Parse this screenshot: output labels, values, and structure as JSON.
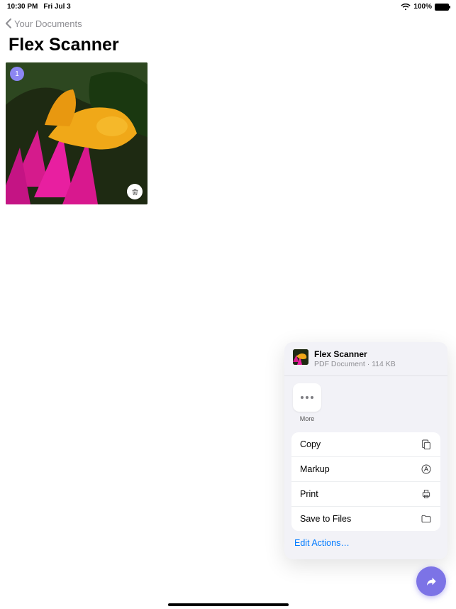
{
  "status": {
    "time": "10:30 PM",
    "date": "Fri Jul 3",
    "battery_pct": "100%"
  },
  "nav": {
    "back_label": "Your Documents"
  },
  "page": {
    "title": "Flex Scanner"
  },
  "thumb": {
    "badge": "1"
  },
  "sheet": {
    "doc_title": "Flex Scanner",
    "doc_meta": "PDF Document · 114 KB",
    "more_label": "More",
    "actions": {
      "copy": "Copy",
      "markup": "Markup",
      "print": "Print",
      "save": "Save to Files"
    },
    "edit_actions": "Edit Actions…"
  }
}
